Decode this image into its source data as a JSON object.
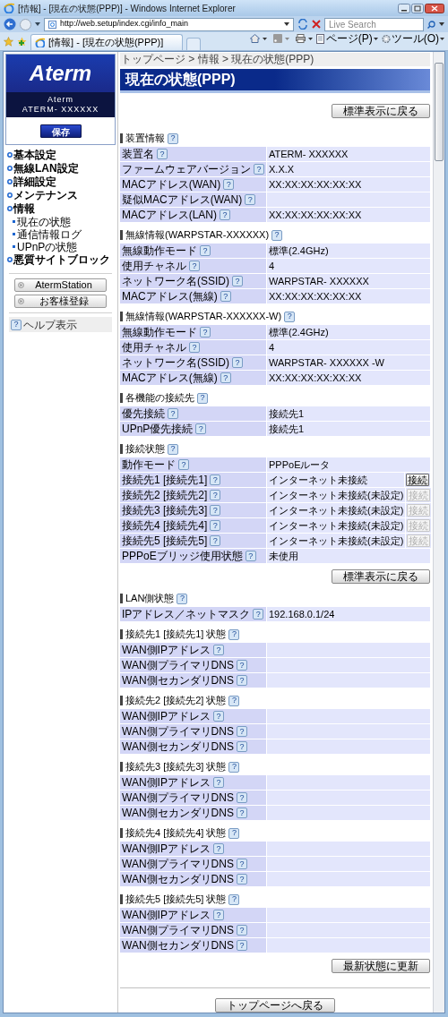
{
  "browser": {
    "title": "[情報] - [現在の状態(PPP)] - Windows Internet Explorer",
    "address": "http://web.setup/index.cgi/info_main",
    "search_placeholder": "Live Search",
    "tab_title": "[情報] - [現在の状態(PPP)]",
    "menus": [
      "ページ(P)",
      "ツール(O)"
    ]
  },
  "sidebar": {
    "logo": "Aterm",
    "device_label": "Aterm",
    "model": "ATERM- XXXXXX",
    "save": "保存",
    "nav": [
      {
        "label": "基本設定"
      },
      {
        "label": "無線LAN設定"
      },
      {
        "label": "詳細設定"
      },
      {
        "label": "メンテナンス"
      },
      {
        "label": "情報",
        "children": [
          "現在の状態",
          "通信情報ログ",
          "UPnPの状態"
        ]
      },
      {
        "label": "悪質サイトブロック"
      }
    ],
    "links": [
      "AtermStation",
      "お客様登録"
    ],
    "help": {
      "icon": "?",
      "label": "ヘルプ表示"
    }
  },
  "main": {
    "breadcrumb": "トップページ > 情報 > 現在の状態(PPP)",
    "title": "現在の状態(PPP)",
    "blocks": [
      {
        "kind": "button",
        "label": "標準表示に戻る"
      },
      {
        "kind": "section",
        "title": "装置情報",
        "help": "?",
        "rows": [
          {
            "label": "装置名",
            "help": "?",
            "value": "ATERM- XXXXXX"
          },
          {
            "label": "ファームウェアバージョン",
            "help": "?",
            "value": "X.X.X"
          },
          {
            "label": "MACアドレス(WAN)",
            "help": "?",
            "value": "XX:XX:XX:XX:XX:XX"
          },
          {
            "label": "疑似MACアドレス(WAN)",
            "help": "?"
          },
          {
            "label": "MACアドレス(LAN)",
            "help": "?",
            "value": "XX:XX:XX:XX:XX:XX"
          }
        ]
      },
      {
        "kind": "section",
        "title": "無線情報(WARPSTAR-XXXXXX)",
        "help": "?",
        "rows": [
          {
            "label": "無線動作モード",
            "help": "?",
            "value": "標準(2.4GHz)"
          },
          {
            "label": "使用チャネル",
            "help": "?",
            "value": "4"
          },
          {
            "label": "ネットワーク名(SSID)",
            "help": "?",
            "value": "WARPSTAR- XXXXXX"
          },
          {
            "label": "MACアドレス(無線)",
            "help": "?",
            "value": "XX:XX:XX:XX:XX:XX"
          }
        ]
      },
      {
        "kind": "section",
        "title": "無線情報(WARPSTAR-XXXXXX-W)",
        "help": "?",
        "rows": [
          {
            "label": "無線動作モード",
            "help": "?",
            "value": "標準(2.4GHz)"
          },
          {
            "label": "使用チャネル",
            "help": "?",
            "value": "4"
          },
          {
            "label": "ネットワーク名(SSID)",
            "help": "?",
            "value": "WARPSTAR- XXXXXX -W"
          },
          {
            "label": "MACアドレス(無線)",
            "help": "?",
            "value": "XX:XX:XX:XX:XX:XX"
          }
        ]
      },
      {
        "kind": "section",
        "title": "各機能の接続先",
        "help": "?",
        "rows": [
          {
            "label": "優先接続",
            "help": "?",
            "value": "接続先1"
          },
          {
            "label": "UPnP優先接続",
            "help": "?",
            "value": "接続先1"
          }
        ]
      },
      {
        "kind": "section",
        "title": "接続状態",
        "help": "?",
        "rows": [
          {
            "label": "動作モード",
            "help": "?",
            "value": "PPPoEルータ"
          },
          {
            "label": "接続先1 [接続先1]",
            "help": "?",
            "value": "インターネット未接続",
            "action": {
              "label": "接続",
              "disabled": false
            }
          },
          {
            "label": "接続先2 [接続先2]",
            "help": "?",
            "value": "インターネット未接続(未設定)",
            "action": {
              "label": "接続",
              "disabled": true
            }
          },
          {
            "label": "接続先3 [接続先3]",
            "help": "?",
            "value": "インターネット未接続(未設定)",
            "action": {
              "label": "接続",
              "disabled": true
            }
          },
          {
            "label": "接続先4 [接続先4]",
            "help": "?",
            "value": "インターネット未接続(未設定)",
            "action": {
              "label": "接続",
              "disabled": true
            }
          },
          {
            "label": "接続先5 [接続先5]",
            "help": "?",
            "value": "インターネット未接続(未設定)",
            "action": {
              "label": "接続",
              "disabled": true
            }
          },
          {
            "label": "PPPoEブリッジ使用状態",
            "help": "?",
            "value": "未使用"
          }
        ]
      },
      {
        "kind": "button",
        "label": "標準表示に戻る"
      },
      {
        "kind": "section",
        "title": "LAN側状態",
        "help": "?",
        "rows": [
          {
            "label": "IPアドレス／ネットマスク",
            "help": "?",
            "value": "192.168.0.1/24"
          }
        ]
      },
      {
        "kind": "section",
        "title": "接続先1 [接続先1] 状態",
        "help": "?",
        "rows": [
          {
            "label": "WAN側IPアドレス",
            "help": "?"
          },
          {
            "label": "WAN側プライマリDNS",
            "help": "?"
          },
          {
            "label": "WAN側セカンダリDNS",
            "help": "?"
          }
        ]
      },
      {
        "kind": "section",
        "title": "接続先2 [接続先2] 状態",
        "help": "?",
        "rows": [
          {
            "label": "WAN側IPアドレス",
            "help": "?"
          },
          {
            "label": "WAN側プライマリDNS",
            "help": "?"
          },
          {
            "label": "WAN側セカンダリDNS",
            "help": "?"
          }
        ]
      },
      {
        "kind": "section",
        "title": "接続先3 [接続先3] 状態",
        "help": "?",
        "rows": [
          {
            "label": "WAN側IPアドレス",
            "help": "?"
          },
          {
            "label": "WAN側プライマリDNS",
            "help": "?"
          },
          {
            "label": "WAN側セカンダリDNS",
            "help": "?"
          }
        ]
      },
      {
        "kind": "section",
        "title": "接続先4 [接続先4] 状態",
        "help": "?",
        "rows": [
          {
            "label": "WAN側IPアドレス",
            "help": "?"
          },
          {
            "label": "WAN側プライマリDNS",
            "help": "?"
          },
          {
            "label": "WAN側セカンダリDNS",
            "help": "?"
          }
        ]
      },
      {
        "kind": "section",
        "title": "接続先5 [接続先5] 状態",
        "help": "?",
        "rows": [
          {
            "label": "WAN側IPアドレス",
            "help": "?"
          },
          {
            "label": "WAN側プライマリDNS",
            "help": "?"
          },
          {
            "label": "WAN側セカンダリDNS",
            "help": "?"
          }
        ]
      },
      {
        "kind": "button",
        "label": "最新状態に更新"
      },
      {
        "kind": "divider"
      },
      {
        "kind": "center_button",
        "label": "トップページへ戻る"
      }
    ]
  }
}
